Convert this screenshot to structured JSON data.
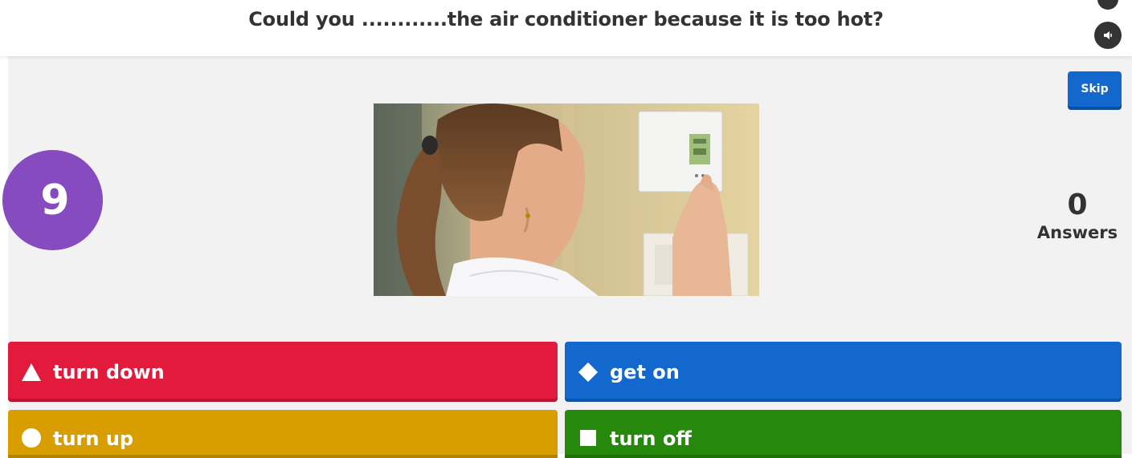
{
  "question": {
    "text": "Could you ............the air conditioner because it is too hot?"
  },
  "controls": {
    "skip_label": "Skip",
    "sound_icon": "speaker-icon"
  },
  "timer": {
    "value": "9"
  },
  "answers_counter": {
    "count": "0",
    "label": "Answers"
  },
  "answers": [
    {
      "label": "turn down",
      "shape": "triangle-icon",
      "color": "#e21b3c"
    },
    {
      "label": "get on",
      "shape": "diamond-icon",
      "color": "#1368ce"
    },
    {
      "label": "turn up",
      "shape": "circle-icon",
      "color": "#d89e00"
    },
    {
      "label": "turn off",
      "shape": "square-icon",
      "color": "#26890c"
    }
  ],
  "colors": {
    "timer": "#864cbf",
    "skip": "#1368ce",
    "stage": "#f2f2f2"
  }
}
